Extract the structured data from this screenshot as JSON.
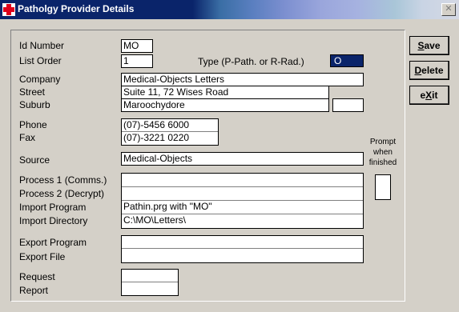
{
  "window": {
    "title": "Patholgy Provider Details",
    "close_glyph": "✕"
  },
  "fields": {
    "id_number": {
      "label": "Id Number",
      "value": "MO"
    },
    "list_order": {
      "label": "List Order",
      "value": "1"
    },
    "type": {
      "label": "Type (P-Path. or R-Rad.)",
      "value": "O"
    },
    "company": {
      "label": "Company",
      "value": "Medical-Objects Letters"
    },
    "street": {
      "label": "Street",
      "value": "Suite 11, 72 Wises Road"
    },
    "suburb": {
      "label": "Suburb",
      "value": "Maroochydore"
    },
    "postcode": {
      "value": ""
    },
    "phone": {
      "label": "Phone",
      "value": "(07)-5456 6000"
    },
    "fax": {
      "label": "Fax",
      "value": "(07)-3221 0220"
    },
    "source": {
      "label": "Source",
      "value": "Medical-Objects"
    },
    "process1": {
      "label": "Process 1 (Comms.)",
      "value": ""
    },
    "process2": {
      "label": "Process 2 (Decrypt)",
      "value": ""
    },
    "import_program": {
      "label": "Import Program",
      "value": "Pathin.prg with \"MO\""
    },
    "import_directory": {
      "label": "Import Directory",
      "value": "C:\\MO\\Letters\\"
    },
    "export_program": {
      "label": "Export Program",
      "value": ""
    },
    "export_file": {
      "label": "Export File",
      "value": ""
    },
    "request": {
      "label": "Request",
      "value": ""
    },
    "report": {
      "label": "Report",
      "value": ""
    },
    "prompt_when_finished": {
      "label": "Prompt when finished",
      "value": ""
    }
  },
  "buttons": {
    "save": {
      "hotkey": "S",
      "rest": "ave"
    },
    "delete": {
      "hotkey": "D",
      "rest": "elete"
    },
    "exit": {
      "pre": "e",
      "hotkey": "X",
      "rest": "it"
    }
  },
  "colors": {
    "titlebar": "#0a246a",
    "face": "#d4d0c8",
    "selection": "#0a246a"
  }
}
